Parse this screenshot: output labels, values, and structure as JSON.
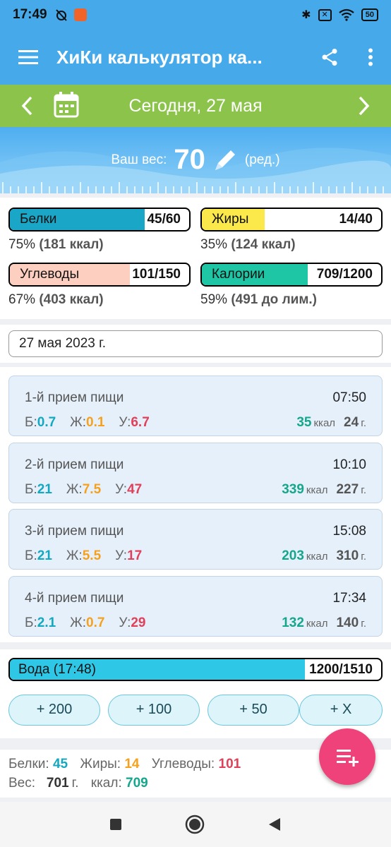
{
  "status": {
    "time": "17:49",
    "battery": "50"
  },
  "appbar": {
    "title": "ХиКи калькулятор ка..."
  },
  "datebar": {
    "date": "Сегодня, 27 мая"
  },
  "weight": {
    "label": "Ваш вес:",
    "value": "70",
    "edit": "(ред.)"
  },
  "macros": [
    {
      "name": "Белки",
      "value": "45/60",
      "fraction": 0.75,
      "color": "#1aa6c6",
      "pct": "75%",
      "kcal": "(181 ккал)"
    },
    {
      "name": "Жиры",
      "value": "14/40",
      "fraction": 0.35,
      "color": "#fbe84b",
      "pct": "35%",
      "kcal": "(124 ккал)"
    },
    {
      "name": "Углеводы",
      "value": "101/150",
      "fraction": 0.67,
      "color": "#fdcfc0",
      "pct": "67%",
      "kcal": "(403 ккал)"
    },
    {
      "name": "Калории",
      "value": "709/1200",
      "fraction": 0.59,
      "color": "#1ec6a6",
      "pct": "59%",
      "kcal": "(491 до лим.)"
    }
  ],
  "date_field": "27 мая 2023 г.",
  "meal_labels": {
    "b": "Б:",
    "f": "Ж:",
    "c": "У:",
    "kcal_unit": "ккал",
    "gram_unit": "г."
  },
  "meals": [
    {
      "name": "1-й прием пищи",
      "time": "07:50",
      "b": "0.7",
      "f": "0.1",
      "c": "6.7",
      "kcal": "35",
      "grams": "24"
    },
    {
      "name": "2-й прием пищи",
      "time": "10:10",
      "b": "21",
      "f": "7.5",
      "c": "47",
      "kcal": "339",
      "grams": "227"
    },
    {
      "name": "3-й прием пищи",
      "time": "15:08",
      "b": "21",
      "f": "5.5",
      "c": "17",
      "kcal": "203",
      "grams": "310"
    },
    {
      "name": "4-й прием пищи",
      "time": "17:34",
      "b": "2.1",
      "f": "0.7",
      "c": "29",
      "kcal": "132",
      "grams": "140"
    }
  ],
  "water": {
    "label": "Вода (17:48)",
    "value": "1200/1510",
    "fraction": 0.795,
    "color": "#2ec8e6",
    "buttons": [
      "+ 200",
      "+ 100",
      "+ 50",
      "+ X"
    ]
  },
  "totals": {
    "protein_label": "Белки:",
    "protein": "45",
    "fat_label": "Жиры:",
    "fat": "14",
    "carbs_label": "Углеводы:",
    "carbs": "101",
    "weight_label": "Вес:",
    "weight": "701",
    "weight_unit": "г.",
    "kcal_label": "ккал:",
    "kcal": "709"
  }
}
